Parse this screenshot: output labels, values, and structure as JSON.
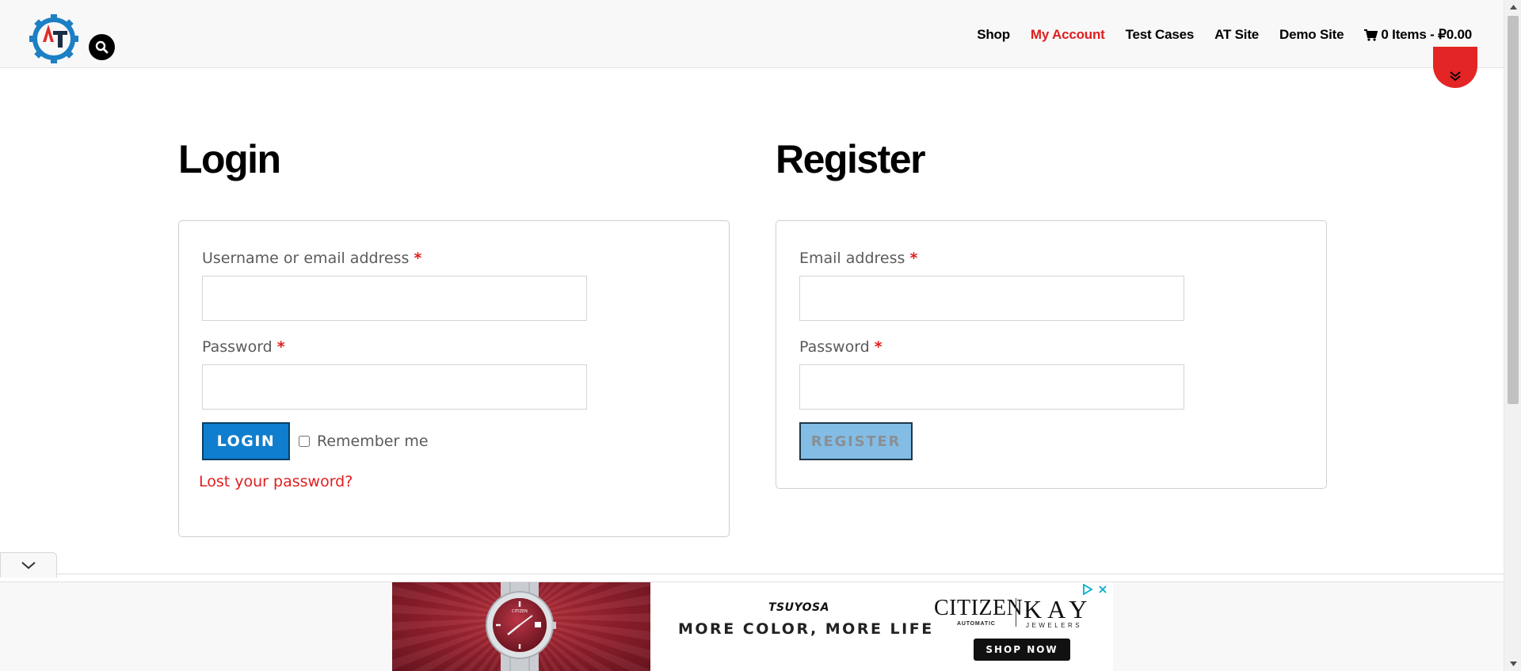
{
  "header": {
    "logo_alt": "AT",
    "nav": [
      {
        "label": "Shop",
        "active": false
      },
      {
        "label": "My Account",
        "active": true
      },
      {
        "label": "Test Cases",
        "active": false
      },
      {
        "label": "AT Site",
        "active": false
      },
      {
        "label": "Demo Site",
        "active": false
      }
    ],
    "cart_label": "0 Items - ₽0.00"
  },
  "login": {
    "title": "Login",
    "username_label": "Username or email address",
    "username_value": "",
    "password_label": "Password",
    "password_value": "",
    "required_mark": "*",
    "login_button": "LOGIN",
    "remember_label": "Remember me",
    "remember_checked": false,
    "lost_password": "Lost your password?"
  },
  "register": {
    "title": "Register",
    "email_label": "Email address",
    "email_value": "",
    "password_label": "Password",
    "password_value": "",
    "required_mark": "*",
    "register_button": "REGISTER"
  },
  "ad": {
    "brand_small": "TSUYOSA",
    "tagline": "MORE COLOR, MORE LIFE",
    "brand_citizen": "CITIZEN",
    "citizen_sub": "AUTOMATIC",
    "brand_kay": "KAY",
    "kay_sub": "JEWELERS",
    "cta": "SHOP NOW",
    "watch_brand": "CITIZEN"
  },
  "colors": {
    "accent_red": "#e01e1e",
    "login_button": "#0f7ecf",
    "register_button": "#83bde6",
    "header_bg": "#f8f8f8"
  },
  "icons": [
    "search-icon",
    "cart-icon",
    "chevrons-down-icon",
    "chevron-down-icon",
    "adchoices-icon",
    "close-icon"
  ]
}
